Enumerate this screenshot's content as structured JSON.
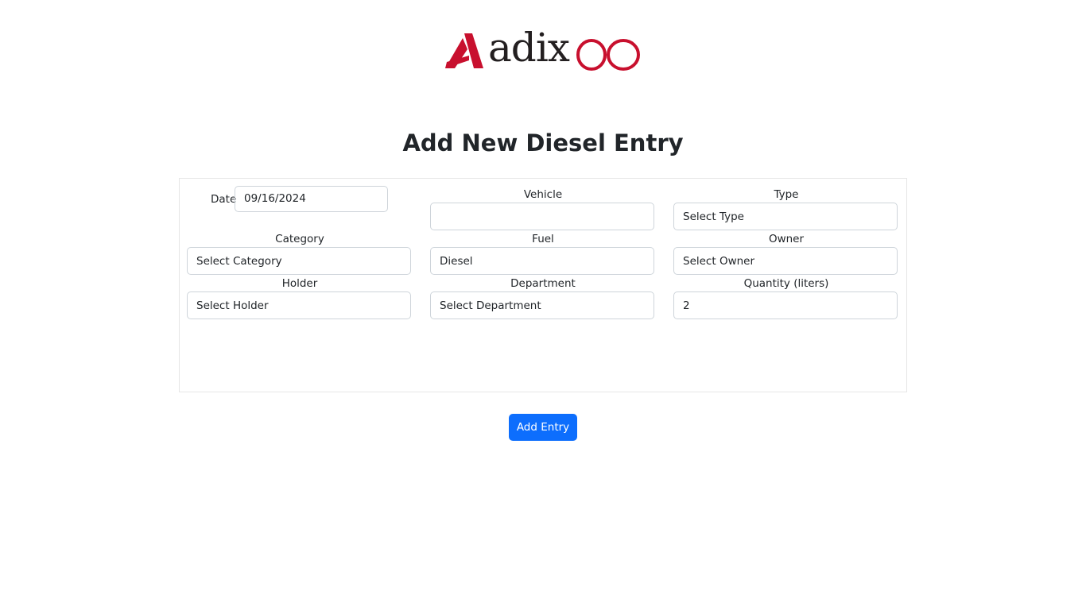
{
  "logo": {
    "text": "adix",
    "brand_color": "#c8102e",
    "text_color": "#231f20"
  },
  "page": {
    "title": "Add New Diesel Entry"
  },
  "form": {
    "date": {
      "label": "Date",
      "value": "09/16/2024"
    },
    "vehicle": {
      "label": "Vehicle",
      "value": ""
    },
    "type": {
      "label": "Type",
      "value": "Select Type"
    },
    "category": {
      "label": "Category",
      "value": "Select Category"
    },
    "fuel": {
      "label": "Fuel",
      "value": "Diesel"
    },
    "owner": {
      "label": "Owner",
      "value": "Select Owner"
    },
    "holder": {
      "label": "Holder",
      "value": "Select Holder"
    },
    "department": {
      "label": "Department",
      "value": "Select Department"
    },
    "quantity": {
      "label": "Quantity (liters)",
      "value": "2"
    }
  },
  "actions": {
    "add_entry_label": "Add Entry"
  },
  "colors": {
    "primary": "#0d6efd",
    "border": "#ced4da"
  }
}
